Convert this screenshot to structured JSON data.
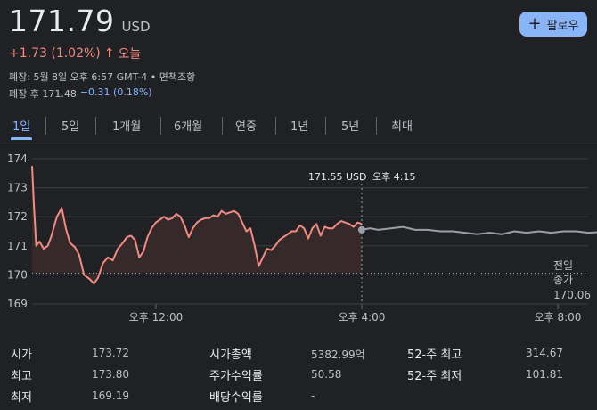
{
  "quote": {
    "price": "171.79",
    "currency": "USD",
    "change": "+1.73 (1.02%)",
    "change_arrow": "↑",
    "period": "오늘",
    "meta_line1": "폐장: 5월 8일 오후 6:57 GMT-4 • 면책조항",
    "after_hours_label": "폐장 후 171.48",
    "after_hours_change": "−0.31 (0.18%)"
  },
  "follow_button": {
    "label": "팔로우",
    "icon": "plus-icon"
  },
  "tabs": [
    {
      "label": "1일",
      "active": true
    },
    {
      "label": "5일",
      "active": false
    },
    {
      "label": "1개월",
      "active": false
    },
    {
      "label": "6개월",
      "active": false
    },
    {
      "label": "연중",
      "active": false
    },
    {
      "label": "1년",
      "active": false
    },
    {
      "label": "5년",
      "active": false
    },
    {
      "label": "최대",
      "active": false
    }
  ],
  "chart_data": {
    "type": "line",
    "y_ticks": [
      "174",
      "173",
      "172",
      "171",
      "170",
      "169"
    ],
    "ylim": [
      169,
      174
    ],
    "x_ticks": [
      "오후 12:00",
      "오후 4:00",
      "오후 8:00"
    ],
    "hover_value": "171.55 USD",
    "hover_time": "오후 4:15",
    "prev_close_label_1": "전일",
    "prev_close_label_2": "종가",
    "prev_close_value": "170.06",
    "previous_close": 170.06,
    "regular_session": [
      [
        0.0,
        173.75
      ],
      [
        0.02,
        172.5
      ],
      [
        0.05,
        171.0
      ],
      [
        0.09,
        171.15
      ],
      [
        0.14,
        170.9
      ],
      [
        0.19,
        171.0
      ],
      [
        0.23,
        171.3
      ],
      [
        0.3,
        172.0
      ],
      [
        0.36,
        172.3
      ],
      [
        0.41,
        171.6
      ],
      [
        0.46,
        171.1
      ],
      [
        0.52,
        170.95
      ],
      [
        0.57,
        170.7
      ],
      [
        0.63,
        170.0
      ],
      [
        0.7,
        169.85
      ],
      [
        0.75,
        169.7
      ],
      [
        0.8,
        169.9
      ],
      [
        0.86,
        170.4
      ],
      [
        0.92,
        170.6
      ],
      [
        0.98,
        170.5
      ],
      [
        1.04,
        170.9
      ],
      [
        1.1,
        171.1
      ],
      [
        1.15,
        171.3
      ],
      [
        1.2,
        171.35
      ],
      [
        1.25,
        171.2
      ],
      [
        1.3,
        170.6
      ],
      [
        1.35,
        170.8
      ],
      [
        1.4,
        171.3
      ],
      [
        1.45,
        171.6
      ],
      [
        1.5,
        171.8
      ],
      [
        1.55,
        171.9
      ],
      [
        1.6,
        172.0
      ],
      [
        1.65,
        171.9
      ],
      [
        1.7,
        171.95
      ],
      [
        1.75,
        172.1
      ],
      [
        1.8,
        172.0
      ],
      [
        1.85,
        171.7
      ],
      [
        1.9,
        171.3
      ],
      [
        1.95,
        171.6
      ],
      [
        2.0,
        171.8
      ],
      [
        2.05,
        171.9
      ],
      [
        2.1,
        171.95
      ],
      [
        2.15,
        171.95
      ],
      [
        2.2,
        172.05
      ],
      [
        2.25,
        172.0
      ],
      [
        2.3,
        172.2
      ],
      [
        2.35,
        172.1
      ],
      [
        2.4,
        172.15
      ],
      [
        2.45,
        172.2
      ],
      [
        2.5,
        172.1
      ],
      [
        2.55,
        171.8
      ],
      [
        2.6,
        171.5
      ],
      [
        2.65,
        171.6
      ],
      [
        2.7,
        171.0
      ],
      [
        2.75,
        170.3
      ],
      [
        2.8,
        170.6
      ],
      [
        2.85,
        170.9
      ],
      [
        2.9,
        170.85
      ],
      [
        2.95,
        171.0
      ],
      [
        3.0,
        171.2
      ],
      [
        3.05,
        171.3
      ],
      [
        3.1,
        171.4
      ],
      [
        3.15,
        171.5
      ],
      [
        3.2,
        171.5
      ],
      [
        3.25,
        171.7
      ],
      [
        3.3,
        171.6
      ],
      [
        3.35,
        171.25
      ],
      [
        3.4,
        171.6
      ],
      [
        3.45,
        171.75
      ],
      [
        3.5,
        171.35
      ],
      [
        3.55,
        171.65
      ],
      [
        3.6,
        171.6
      ],
      [
        3.65,
        171.6
      ],
      [
        3.7,
        171.75
      ],
      [
        3.75,
        171.85
      ],
      [
        3.8,
        171.8
      ],
      [
        3.85,
        171.75
      ],
      [
        3.9,
        171.65
      ],
      [
        3.95,
        171.8
      ],
      [
        4.0,
        171.75
      ]
    ],
    "after_hours": [
      [
        4.0,
        171.55
      ],
      [
        4.1,
        171.6
      ],
      [
        4.2,
        171.55
      ],
      [
        4.35,
        171.6
      ],
      [
        4.5,
        171.65
      ],
      [
        4.65,
        171.55
      ],
      [
        4.8,
        171.55
      ],
      [
        4.95,
        171.5
      ],
      [
        5.1,
        171.5
      ],
      [
        5.25,
        171.45
      ],
      [
        5.4,
        171.4
      ],
      [
        5.55,
        171.45
      ],
      [
        5.7,
        171.4
      ],
      [
        5.85,
        171.5
      ],
      [
        6.0,
        171.45
      ],
      [
        6.15,
        171.5
      ],
      [
        6.3,
        171.45
      ],
      [
        6.45,
        171.5
      ],
      [
        6.6,
        171.5
      ],
      [
        6.75,
        171.45
      ],
      [
        6.9,
        171.48
      ],
      [
        7.05,
        171.5
      ],
      [
        7.2,
        171.48
      ],
      [
        7.35,
        171.48
      ]
    ],
    "colors": {
      "line": "#f28b82",
      "after_hours_line": "#9aa0a6",
      "fill": "#3b2a2a"
    }
  },
  "stats": [
    {
      "label": "시가",
      "value": "173.72"
    },
    {
      "label": "최고",
      "value": "173.80"
    },
    {
      "label": "최저",
      "value": "169.19"
    },
    {
      "label": "시가총액",
      "value": "5382.99억"
    },
    {
      "label": "주가수익률",
      "value": "50.58"
    },
    {
      "label": "배당수익률",
      "value": "-"
    },
    {
      "label": "52-주 최고",
      "value": "314.67"
    },
    {
      "label": "52-주 최저",
      "value": "101.81"
    }
  ]
}
